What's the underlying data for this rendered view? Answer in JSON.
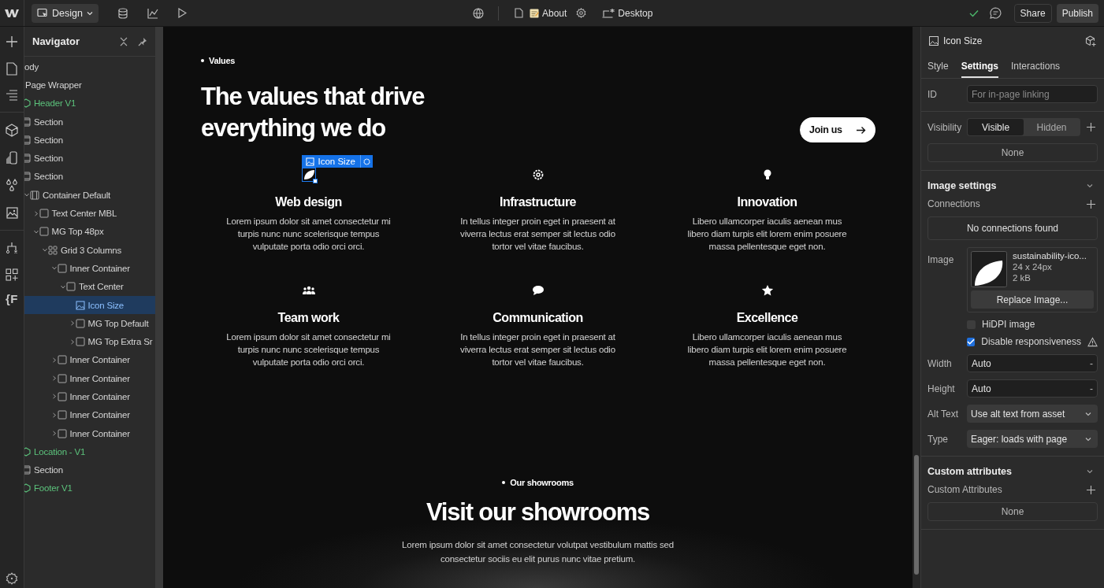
{
  "toolbar": {
    "mode": "Design",
    "page": "About",
    "breakpoint": "Desktop",
    "share": "Share",
    "publish": "Publish"
  },
  "rail": {
    "extension": "{F"
  },
  "navigator": {
    "title": "Navigator",
    "tree": [
      {
        "label": "ody",
        "selected": false,
        "children": [
          {
            "label": "Page Wrapper",
            "selected": false,
            "children": [
              {
                "label": "Header V1",
                "kind": "component",
                "selected": false
              },
              {
                "label": "Section",
                "kind": "section",
                "selected": false
              },
              {
                "label": "Section",
                "kind": "section",
                "selected": false
              },
              {
                "label": "Section",
                "kind": "section",
                "selected": false
              },
              {
                "label": "Section",
                "kind": "section",
                "selected": false,
                "children": [
                  {
                    "label": "Container Default",
                    "kind": "container",
                    "selected": false,
                    "expanded": true,
                    "children": [
                      {
                        "label": "Text Center MBL",
                        "kind": "box",
                        "selected": false,
                        "expanded": false
                      },
                      {
                        "label": "MG Top 48px",
                        "kind": "box",
                        "selected": false,
                        "expanded": true,
                        "children": [
                          {
                            "label": "Grid 3 Columns",
                            "kind": "grid",
                            "selected": false,
                            "expanded": true,
                            "children": [
                              {
                                "label": "Inner Container",
                                "kind": "box",
                                "selected": false,
                                "expanded": true,
                                "children": [
                                  {
                                    "label": "Text Center",
                                    "kind": "box",
                                    "selected": false,
                                    "expanded": true,
                                    "children": [
                                      {
                                        "label": "Icon Size",
                                        "kind": "image",
                                        "selected": true
                                      },
                                      {
                                        "label": "MG Top Default",
                                        "kind": "box",
                                        "selected": false,
                                        "expanded": false
                                      },
                                      {
                                        "label": "MG Top Extra Sr",
                                        "kind": "box",
                                        "selected": false,
                                        "expanded": false
                                      }
                                    ]
                                  }
                                ]
                              },
                              {
                                "label": "Inner Container",
                                "kind": "box",
                                "selected": false,
                                "expanded": false
                              },
                              {
                                "label": "Inner Container",
                                "kind": "box",
                                "selected": false,
                                "expanded": false
                              },
                              {
                                "label": "Inner Container",
                                "kind": "box",
                                "selected": false,
                                "expanded": false
                              },
                              {
                                "label": "Inner Container",
                                "kind": "box",
                                "selected": false,
                                "expanded": false
                              },
                              {
                                "label": "Inner Container",
                                "kind": "box",
                                "selected": false,
                                "expanded": false
                              }
                            ]
                          }
                        ]
                      }
                    ]
                  }
                ]
              },
              {
                "label": "Location - V1",
                "kind": "component",
                "selected": false
              },
              {
                "label": "Section",
                "kind": "section",
                "selected": false
              },
              {
                "label": "Footer V1",
                "kind": "component",
                "selected": false
              }
            ]
          }
        ]
      }
    ]
  },
  "canvas": {
    "eyebrow": "Values",
    "heading": "The values that drive everything we do",
    "cta": "Join us",
    "selection_tag": "Icon Size",
    "features": [
      {
        "kind": "leaf",
        "title": "Web design",
        "text": "Lorem ipsum dolor sit amet consectetur mi turpis nunc nunc scelerisque tempus vulputate porta odio orci orci.",
        "selected": true
      },
      {
        "kind": "gear",
        "title": "Infrastructure",
        "text": "In tellus integer proin eget in praesent at viverra lectus erat semper sit lectus odio tortor vel vitae faucibus.",
        "selected": false
      },
      {
        "kind": "bulb",
        "title": "Innovation",
        "text": "Libero ullamcorper iaculis aenean mus libero diam turpis elit lorem enim posuere massa pellentesque eget non.",
        "selected": false
      },
      {
        "kind": "people",
        "title": "Team work",
        "text": "Lorem ipsum dolor sit amet consectetur mi turpis nunc nunc scelerisque tempus vulputate porta odio orci orci.",
        "selected": false
      },
      {
        "kind": "chat",
        "title": "Communication",
        "text": "In tellus integer proin eget in praesent at viverra lectus erat semper sit lectus odio tortor vel vitae faucibus.",
        "selected": false
      },
      {
        "kind": "star",
        "title": "Excellence",
        "text": "Libero ullamcorper iaculis aenean mus libero diam turpis elit lorem enim posuere massa pellentesque eget non.",
        "selected": false
      }
    ],
    "showrooms": {
      "eyebrow": "Our showrooms",
      "heading": "Visit our showrooms",
      "text": "Lorem ipsum dolor sit amet consectetur volutpat vestibulum mattis sed consectetur sociis eu elit purus nunc vitae pretium."
    }
  },
  "panel": {
    "element": "Icon Size",
    "tabs": [
      {
        "label": "Style",
        "selected": false
      },
      {
        "label": "Settings",
        "selected": true
      },
      {
        "label": "Interactions",
        "selected": false
      }
    ],
    "id": {
      "label": "ID",
      "placeholder": "For in-page linking"
    },
    "visibility": {
      "label": "Visibility",
      "options": [
        {
          "label": "Visible",
          "selected": true
        },
        {
          "label": "Hidden",
          "selected": false
        }
      ],
      "conditions": "None"
    },
    "image_settings": {
      "title": "Image settings",
      "connections_label": "Connections",
      "connections": "No connections found",
      "image_label": "Image",
      "file_name": "sustainability-ico...",
      "dimensions": "24 x 24px",
      "size": "2 kB",
      "replace": "Replace Image...",
      "checkboxes": [
        {
          "label": "HiDPI image",
          "checked": false,
          "warning": false
        },
        {
          "label": "Disable responsiveness",
          "checked": true,
          "warning": true
        }
      ],
      "fields": [
        {
          "label": "Width",
          "value": "Auto",
          "unit": "-",
          "kind": "input"
        },
        {
          "label": "Height",
          "value": "Auto",
          "unit": "-",
          "kind": "input"
        },
        {
          "label": "Alt Text",
          "value": "Use alt text from asset",
          "kind": "select"
        },
        {
          "label": "Type",
          "value": "Eager: loads with page",
          "kind": "select"
        }
      ]
    },
    "custom_attributes": {
      "title": "Custom attributes",
      "label": "Custom Attributes",
      "value": "None"
    }
  }
}
